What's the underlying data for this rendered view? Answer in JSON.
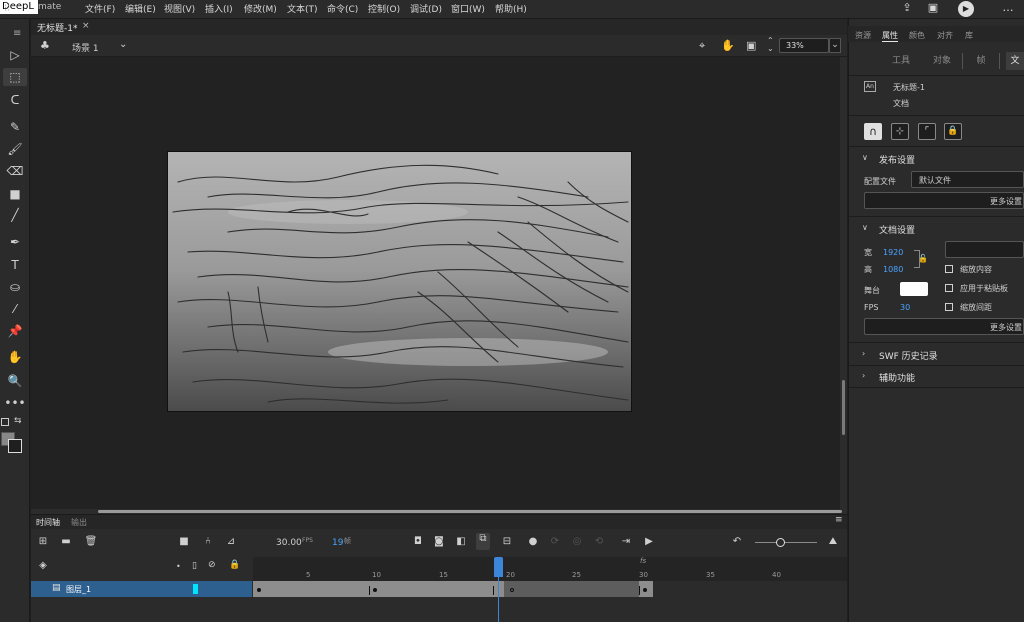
{
  "app": {
    "name_badge": "DeepL",
    "name_tail": "mate"
  },
  "menu": [
    "文件(F)",
    "编辑(E)",
    "视图(V)",
    "插入(I)",
    "修改(M)",
    "文本(T)",
    "命令(C)",
    "控制(O)",
    "调试(D)",
    "窗口(W)",
    "帮助(H)"
  ],
  "document": {
    "tab_title": "无标题-1*",
    "close_glyph": "×",
    "scene_label": "场景 1",
    "zoom": "33%"
  },
  "panel_tabs": [
    "资源",
    "属性",
    "颜色",
    "对齐",
    "库"
  ],
  "panel_active_tab": "属性",
  "segments": [
    "工具",
    "对象",
    "帧",
    "文"
  ],
  "doc_info": {
    "name": "无标题-1",
    "type": "文档",
    "icon_text": "An"
  },
  "publish": {
    "title": "发布设置",
    "profile_label": "配置文件",
    "profile_value": "默认文件",
    "more_label": "更多设置"
  },
  "doc_settings": {
    "title": "文档设置",
    "width_label": "宽",
    "width_value": "1920",
    "height_label": "高",
    "height_value": "1080",
    "stage_label": "舞台",
    "stage_color": "#ffffff",
    "fps_label": "FPS",
    "fps_value": "30",
    "scale_content": "缩放内容",
    "apply_pasteboard": "应用于粘贴板",
    "scale_spacing": "缩放间距",
    "more_label": "更多设置"
  },
  "swf_history": "SWF 历史记录",
  "accessibility": "辅助功能",
  "timeline": {
    "tab_timeline": "时间轴",
    "tab_output": "输出",
    "fps_value": "30.00",
    "fps_unit": "FPS",
    "frame_value": "19",
    "frame_unit": "帧",
    "fs_label": "fs",
    "layer_name": "图层_1",
    "ruler": [
      "5",
      "10",
      "15",
      "20",
      "25",
      "30",
      "35",
      "40"
    ],
    "current_frame": 19
  },
  "colors": {
    "accent": "#4a90e2",
    "layer_selected": "#2d5f8f",
    "layer_color_tag": "#00e5ff",
    "playhead": "#3b86d8"
  }
}
